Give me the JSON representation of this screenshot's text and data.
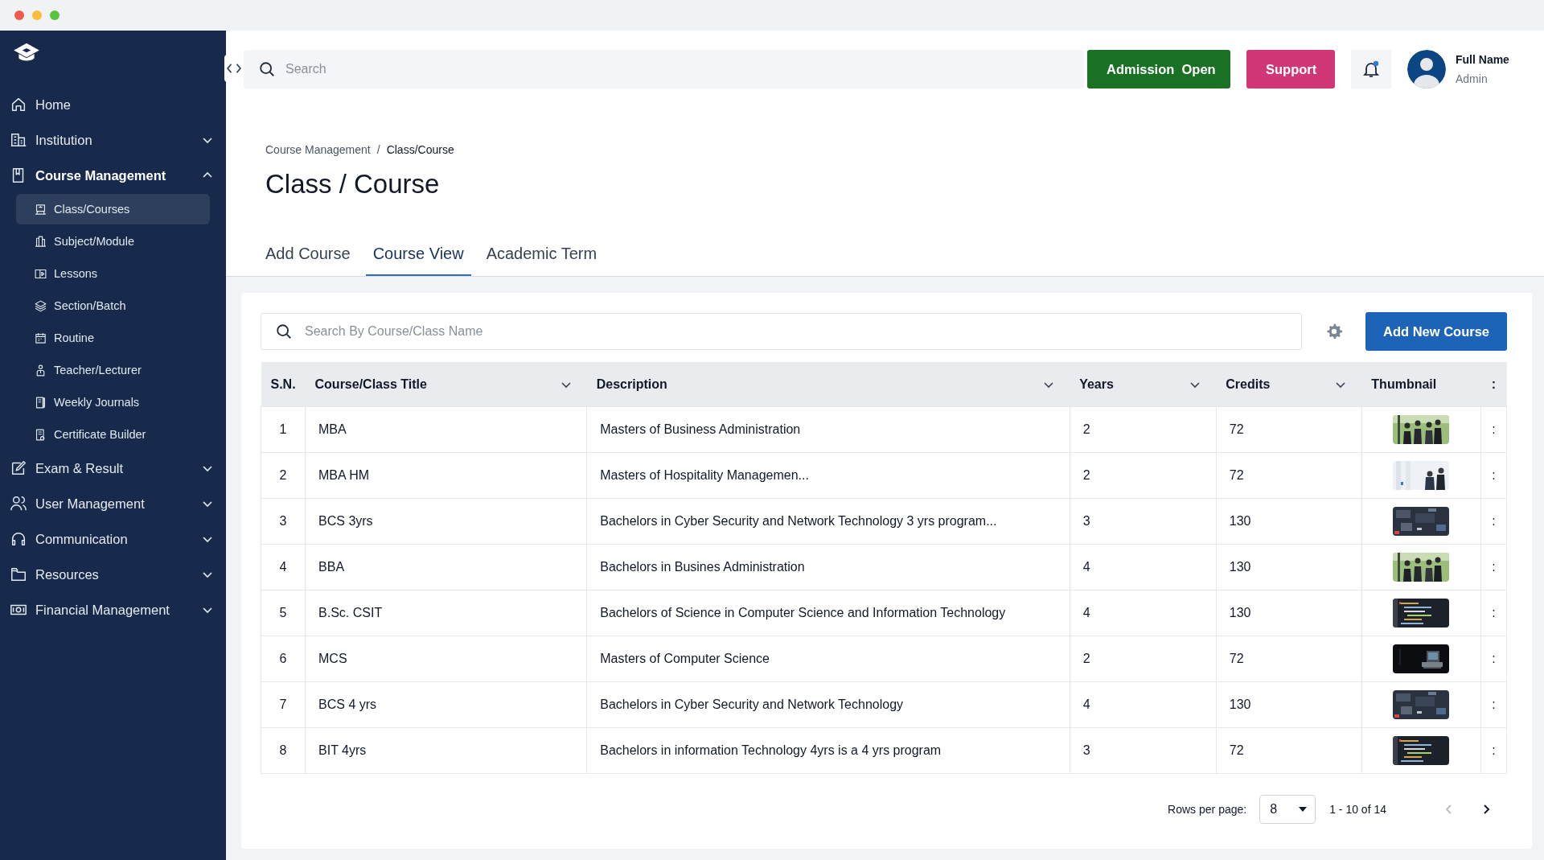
{
  "sidebar": {
    "items": [
      {
        "label": "Home",
        "kind": "link",
        "expanded": false
      },
      {
        "label": "Institution",
        "kind": "group",
        "expanded": false
      },
      {
        "label": "Course Management",
        "kind": "group",
        "expanded": true,
        "children": [
          {
            "label": "Class/Courses",
            "selected": true
          },
          {
            "label": "Subject/Module",
            "selected": false
          },
          {
            "label": "Lessons",
            "selected": false
          },
          {
            "label": "Section/Batch",
            "selected": false
          },
          {
            "label": "Routine",
            "selected": false
          },
          {
            "label": "Teacher/Lecturer",
            "selected": false
          },
          {
            "label": "Weekly Journals",
            "selected": false
          },
          {
            "label": "Certificate Builder",
            "selected": false
          }
        ]
      },
      {
        "label": "Exam & Result",
        "kind": "group",
        "expanded": false
      },
      {
        "label": "User Management",
        "kind": "group",
        "expanded": false
      },
      {
        "label": "Communication",
        "kind": "group",
        "expanded": false
      },
      {
        "label": "Resources",
        "kind": "group",
        "expanded": false
      },
      {
        "label": "Financial Management",
        "kind": "group",
        "expanded": false
      }
    ]
  },
  "header": {
    "search": {
      "placeholder": "Search"
    },
    "buttons": [
      {
        "label": "Admission  Open",
        "kind": "admission"
      },
      {
        "label": "Support",
        "kind": "support"
      }
    ],
    "notifications": {
      "unread": true
    },
    "user": {
      "name": "Full Name",
      "role": "Admin"
    }
  },
  "breadcrumb": {
    "items": [
      "Course Management",
      "Class/Course"
    ],
    "separator": "/"
  },
  "title": "Class / Course",
  "tabs": [
    {
      "label": "Add Course",
      "selected": false
    },
    {
      "label": "Course View",
      "selected": true
    },
    {
      "label": "Academic Term",
      "selected": false
    }
  ],
  "table_search": {
    "placeholder": "Search By Course/Class Name"
  },
  "add_button": "Add New Course",
  "table": {
    "columns": [
      {
        "label": "S.N.",
        "sortable": false
      },
      {
        "label": "Course/Class Title",
        "sortable": true
      },
      {
        "label": "Description",
        "sortable": true
      },
      {
        "label": "Years",
        "sortable": true
      },
      {
        "label": "Credits",
        "sortable": true
      },
      {
        "label": "Thumbnail",
        "sortable": false
      },
      {
        "label": ":",
        "sortable": false
      }
    ],
    "rows": [
      {
        "sn": "1",
        "title": "MBA",
        "description": "Masters of Business Administration",
        "years": "2",
        "credits": "72",
        "menu": ":"
      },
      {
        "sn": "2",
        "title": "MBA HM",
        "description": "Masters of Hospitality Managemen...",
        "years": "2",
        "credits": "72",
        "menu": ":"
      },
      {
        "sn": "3",
        "title": "BCS 3yrs",
        "description": "Bachelors in Cyber Security and Network Technology 3 yrs program...",
        "years": "3",
        "credits": "130",
        "menu": ":"
      },
      {
        "sn": "4",
        "title": "BBA",
        "description": "Bachelors in Busines Administration",
        "years": "4",
        "credits": "130",
        "menu": ":"
      },
      {
        "sn": "5",
        "title": "B.Sc. CSIT",
        "description": "Bachelors of Science in Computer Science and Information Technology",
        "years": "4",
        "credits": "130",
        "menu": ":"
      },
      {
        "sn": "6",
        "title": "MCS",
        "description": "Masters of Computer Science",
        "years": "2",
        "credits": "72",
        "menu": ":"
      },
      {
        "sn": "7",
        "title": "BCS 4 yrs",
        "description": "Bachelors in Cyber Security and Network Technology",
        "years": "4",
        "credits": "130",
        "menu": ":"
      },
      {
        "sn": "8",
        "title": "BIT 4yrs",
        "description": "Bachelors in information Technology 4yrs is a 4 yrs program",
        "years": "3",
        "credits": "72",
        "menu": ":"
      }
    ]
  },
  "pagination": {
    "rows_label": "Rows per page:",
    "rows_value": "8",
    "range": "1 - 10 of 14",
    "prev_disabled": true,
    "next_disabled": false
  }
}
